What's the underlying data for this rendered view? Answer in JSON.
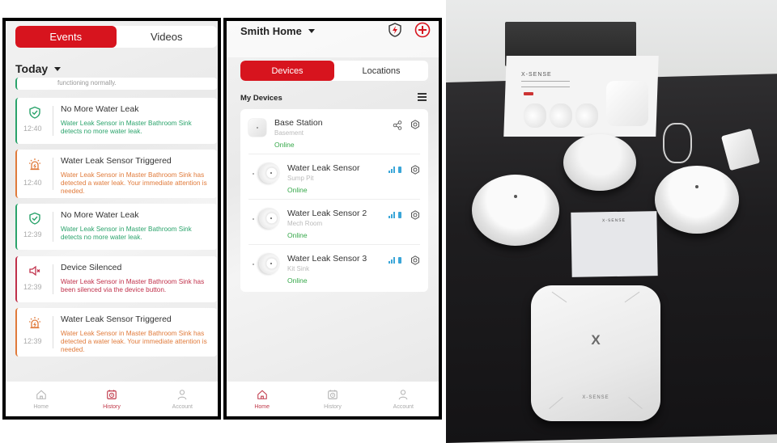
{
  "events_screen": {
    "tabs": [
      {
        "label": "Events",
        "active": true
      },
      {
        "label": "Videos",
        "active": false
      }
    ],
    "date_filter": "Today",
    "clipped_text": "functioning normally.",
    "events": [
      {
        "title": "No More Water Leak",
        "description": "Water Leak Sensor in Master Bathroom Sink detects no more water leak.",
        "time": "12:40",
        "type": "resolved",
        "icon": "shield-check-icon",
        "color": "#2aa36b"
      },
      {
        "title": "Water Leak Sensor Triggered",
        "description": "Water Leak Sensor in Master Bathroom Sink has detected a water leak. Your immediate attention is needed.",
        "time": "12:40",
        "type": "alarm",
        "icon": "alarm-siren-icon",
        "color": "#e07a3a"
      },
      {
        "title": "No More Water Leak",
        "description": "Water Leak Sensor in Master Bathroom Sink detects no more water leak.",
        "time": "12:39",
        "type": "resolved",
        "icon": "shield-check-icon",
        "color": "#2aa36b"
      },
      {
        "title": "Device Silenced",
        "description": "Water Leak Sensor in Master Bathroom Sink has been silenced via the device button.",
        "time": "12:39",
        "type": "silenced",
        "icon": "speaker-mute-icon",
        "color": "#c0304a"
      },
      {
        "title": "Water Leak Sensor Triggered",
        "description": "Water Leak Sensor in Master Bathroom Sink has detected a water leak. Your immediate attention is needed.",
        "time": "12:39",
        "type": "alarm",
        "icon": "alarm-siren-icon",
        "color": "#e07a3a"
      }
    ],
    "nav": [
      {
        "label": "Home",
        "icon": "home-icon",
        "active": false
      },
      {
        "label": "History",
        "icon": "history-icon",
        "active": true
      },
      {
        "label": "Account",
        "icon": "account-icon",
        "active": false
      }
    ]
  },
  "devices_screen": {
    "home_name": "Smith Home",
    "tabs": [
      {
        "label": "Devices",
        "active": true
      },
      {
        "label": "Locations",
        "active": false
      }
    ],
    "section_title": "My Devices",
    "devices": [
      {
        "name": "Base Station",
        "location": "Basement",
        "status": "Online",
        "kind": "base-station"
      },
      {
        "name": "Water Leak Sensor",
        "location": "Sump Pit",
        "status": "Online",
        "kind": "sensor"
      },
      {
        "name": "Water Leak Sensor 2",
        "location": "Mech Room",
        "status": "Online",
        "kind": "sensor"
      },
      {
        "name": "Water Leak Sensor 3",
        "location": "Kit Sink",
        "status": "Online",
        "kind": "sensor"
      }
    ],
    "nav": [
      {
        "label": "Home",
        "icon": "home-icon",
        "active": true
      },
      {
        "label": "History",
        "icon": "history-icon",
        "active": false
      },
      {
        "label": "Account",
        "icon": "account-icon",
        "active": false
      }
    ]
  },
  "photo": {
    "brand": "X-SENSE",
    "hub_logo": "X"
  },
  "colors": {
    "accent": "#d7141e",
    "online": "#36a84a",
    "signal": "#3ba6d8"
  }
}
